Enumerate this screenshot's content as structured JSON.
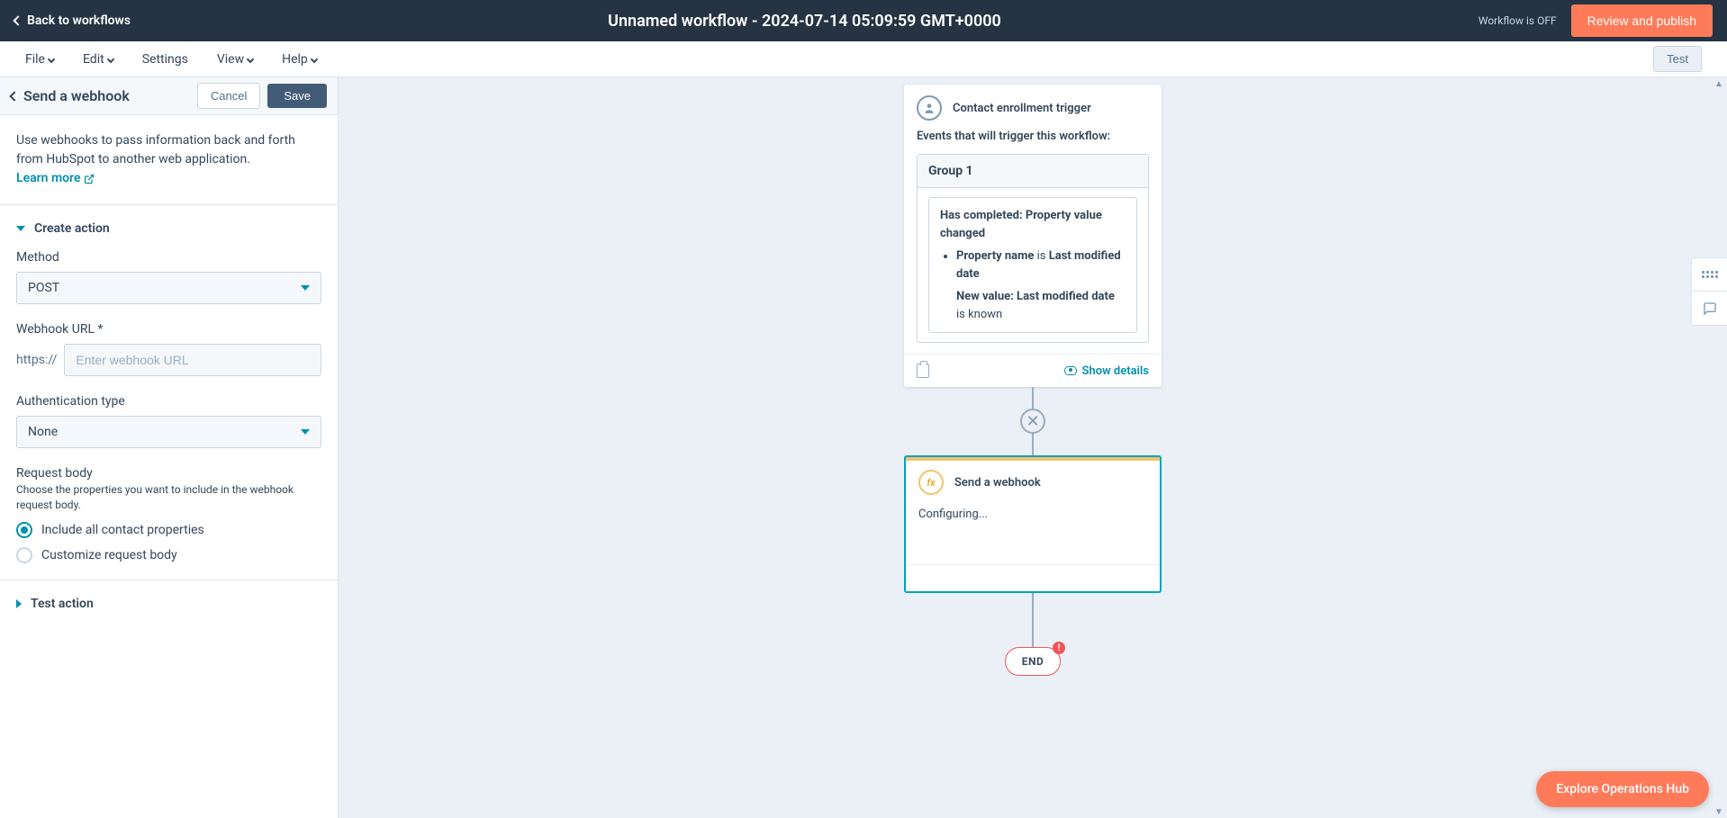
{
  "header": {
    "back_label": "Back to workflows",
    "title": "Unnamed workflow - 2024-07-14 05:09:59 GMT+0000",
    "status": "Workflow is OFF",
    "review_label": "Review and publish"
  },
  "menu": {
    "file": "File",
    "edit": "Edit",
    "settings": "Settings",
    "view": "View",
    "help": "Help",
    "test": "Test"
  },
  "panel": {
    "title": "Send a webhook",
    "cancel": "Cancel",
    "save": "Save",
    "intro": "Use webhooks to pass information back and forth from HubSpot to another web application. ",
    "learn_more": "Learn more",
    "create_action": "Create action",
    "method_label": "Method",
    "method_value": "POST",
    "url_label": "Webhook URL *",
    "url_prefix": "https://",
    "url_placeholder": "Enter webhook URL",
    "auth_label": "Authentication type",
    "auth_value": "None",
    "body_label": "Request body",
    "body_help": "Choose the properties you want to include in the webhook request body.",
    "radio_all": "Include all contact properties",
    "radio_custom": "Customize request body",
    "test_action": "Test action"
  },
  "canvas": {
    "trigger_title": "Contact enrollment trigger",
    "trigger_sub": "Events that will trigger this workflow:",
    "group_label": "Group 1",
    "cond_title": "Has completed: Property value changed",
    "cond_prop_label": "Property name",
    "cond_is": " is ",
    "cond_prop_value": "Last modified date",
    "cond_newval_label": "New value: Last modified date",
    "cond_known": " is known",
    "show_details": "Show details",
    "webhook_title": "Send a webhook",
    "webhook_status": "Configuring...",
    "end_label": "END",
    "end_badge": "!"
  },
  "footer": {
    "explore": "Explore Operations Hub"
  }
}
